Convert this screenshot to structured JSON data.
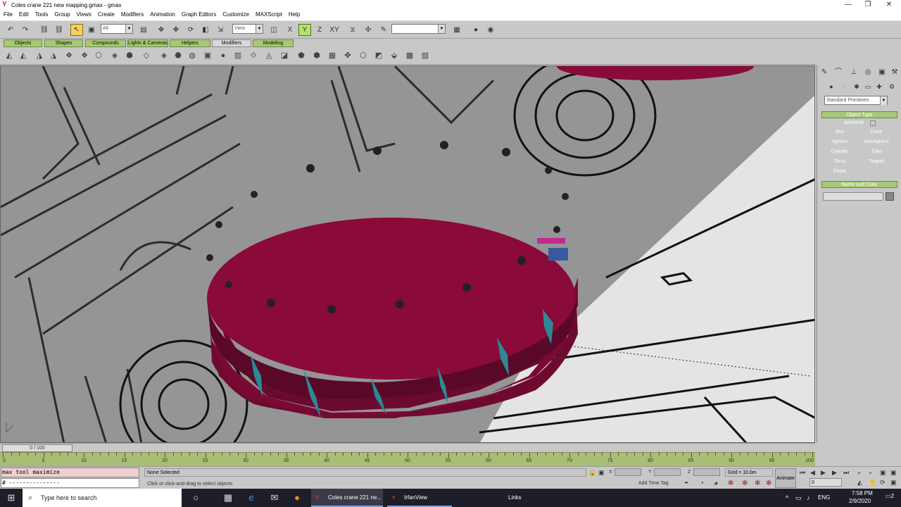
{
  "window": {
    "title": "Coles crane 221 new mapping.gmax - gmax",
    "min_label": "—",
    "max_label": "❐",
    "close_label": "✕"
  },
  "menu": [
    "File",
    "Edit",
    "Tools",
    "Group",
    "Views",
    "Create",
    "Modifiers",
    "Animation",
    "Graph Editors",
    "Customize",
    "MAXScript",
    "Help"
  ],
  "toolbar": {
    "selection_filter": "All",
    "ref_coord": "View",
    "named_sel": ""
  },
  "tabs": [
    "Objects",
    "Shapes",
    "Compounds",
    "Lights & Cameras",
    "Helpers",
    "Modifiers",
    "Modeling"
  ],
  "selected_tab": "Modifiers",
  "command_panel": {
    "category_dropdown": "Standard Primitives",
    "object_type_header": "Object Type",
    "autogrid_label": "AutoGrid",
    "object_buttons": [
      "Box",
      "Cone",
      "Sphere",
      "GeoSphere",
      "Cylinder",
      "Tube",
      "Torus",
      "Teapot",
      "Plane"
    ],
    "name_color_header": "Name and Color",
    "name_value": ""
  },
  "timeline": {
    "slider_label": "0 / 100",
    "ticks": [
      "0",
      "5",
      "10",
      "15",
      "20",
      "25",
      "30",
      "35",
      "40",
      "45",
      "50",
      "55",
      "60",
      "65",
      "70",
      "75",
      "80",
      "85",
      "90",
      "95",
      "100"
    ]
  },
  "status": {
    "maxscript_line1": "max tool maximize",
    "maxscript_line2": "# ---------------",
    "selection": "None Selected",
    "prompt": "Click or click-and-drag to select objects",
    "x_label": "X",
    "y_label": "Y",
    "z_label": "Z",
    "grid": "Grid = 10.0m",
    "add_time_tag": "Add Time Tag",
    "animate": "Animate",
    "frame_value": "0"
  },
  "taskbar": {
    "search_placeholder": "Type here to search",
    "app1": "Coles crane 221 ne...",
    "app2": "IrfanView",
    "links": "Links",
    "lang": "ENG",
    "time": "7:58 PM",
    "date": "2/9/2020",
    "notifications": "2"
  },
  "colors": {
    "object_fill": "#8a0a3a",
    "tab_green": "#a8c878",
    "active_tool": "#f4d060"
  }
}
